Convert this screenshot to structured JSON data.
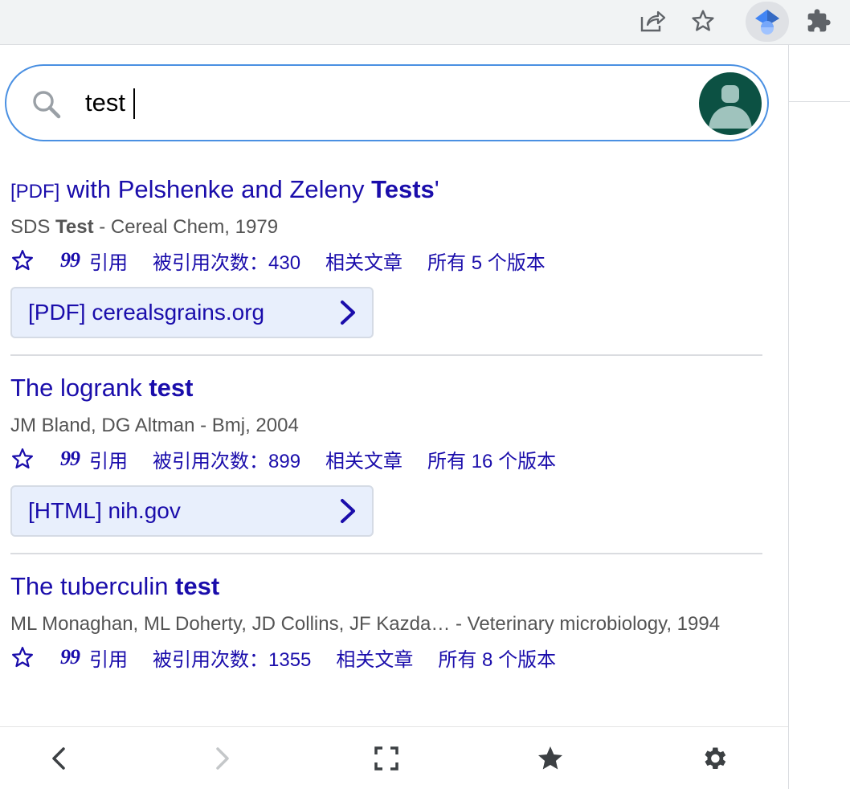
{
  "browser": {
    "share_icon": "share-icon",
    "bookmark_icon": "star-outline-icon",
    "extension_icon": "google-scholar-cap-icon",
    "extensions_icon": "puzzle-piece-icon"
  },
  "search": {
    "value": "test",
    "icon": "search-icon",
    "avatar": "account-avatar"
  },
  "results": [
    {
      "tag": "[PDF]",
      "title_before": " with Pelshenke and Zeleny ",
      "title_bold": "Tests",
      "title_after": "'",
      "meta_before": "SDS ",
      "meta_bold": "Test",
      "meta_after": " - Cereal Chem, 1979",
      "cite": "引用",
      "cited_by": "被引用次数：430",
      "related": "相关文章",
      "versions": "所有 5 个版本",
      "link": "[PDF] cerealsgrains.org"
    },
    {
      "tag": "",
      "title_before": "The logrank ",
      "title_bold": "test",
      "title_after": "",
      "meta_before": "JM Bland, DG Altman - Bmj, 2004",
      "meta_bold": "",
      "meta_after": "",
      "cite": "引用",
      "cited_by": "被引用次数：899",
      "related": "相关文章",
      "versions": "所有 16 个版本",
      "link": "[HTML] nih.gov"
    },
    {
      "tag": "",
      "title_before": "The tuberculin ",
      "title_bold": "test",
      "title_after": "",
      "meta_before": "ML Monaghan, ML Doherty, JD Collins, JF Kazda… - Veterinary microbiology, 1994",
      "meta_bold": "",
      "meta_after": "",
      "cite": "引用",
      "cited_by": "被引用次数：1355",
      "related": "相关文章",
      "versions": "所有 8 个版本",
      "link": ""
    }
  ],
  "bottom_bar": {
    "back_icon": "chevron-left-icon",
    "forward_icon": "chevron-right-icon",
    "fullscreen_icon": "fullscreen-icon",
    "library_icon": "star-filled-icon",
    "settings_icon": "gear-icon"
  },
  "colors": {
    "link": "#1a0dab",
    "meta": "#545454",
    "search_border": "#4a90e2",
    "avatar_bg": "#0c5143",
    "link_chip_bg": "#e8effc"
  }
}
